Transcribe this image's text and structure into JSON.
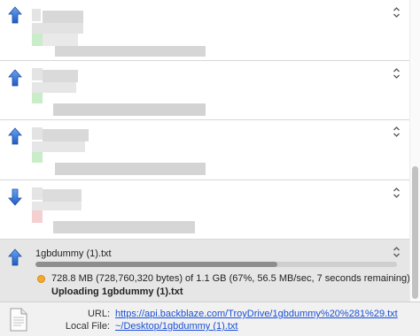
{
  "transfers": [
    {
      "direction": "upload",
      "icon": "up-arrow-icon",
      "redacted": true
    },
    {
      "direction": "upload",
      "icon": "up-arrow-icon",
      "redacted": true
    },
    {
      "direction": "upload",
      "icon": "up-arrow-icon",
      "redacted": true
    },
    {
      "direction": "download",
      "icon": "down-arrow-icon",
      "redacted": true
    }
  ],
  "active_transfer": {
    "direction": "upload",
    "filename": "1gbdummy (1).txt",
    "progress_percent": 67,
    "stats": "728.8 MB (728,760,320 bytes) of 1.1 GB (67%, 56.5 MB/sec, 7 seconds remaining)",
    "status": "Uploading 1gbdummy (1).txt",
    "status_dot_color": "#f3a92e"
  },
  "footer": {
    "url_label": "URL:",
    "url_value": "https://api.backblaze.com/TroyDrive/1gbdummy%20%281%29.txt",
    "local_file_label": "Local File:",
    "local_file_value": "~/Desktop/1gbdummy (1).txt"
  },
  "colors": {
    "arrow_fill": "#2d6fd8",
    "link": "#1a4fd6",
    "active_row_bg": "#e6e6e6"
  }
}
